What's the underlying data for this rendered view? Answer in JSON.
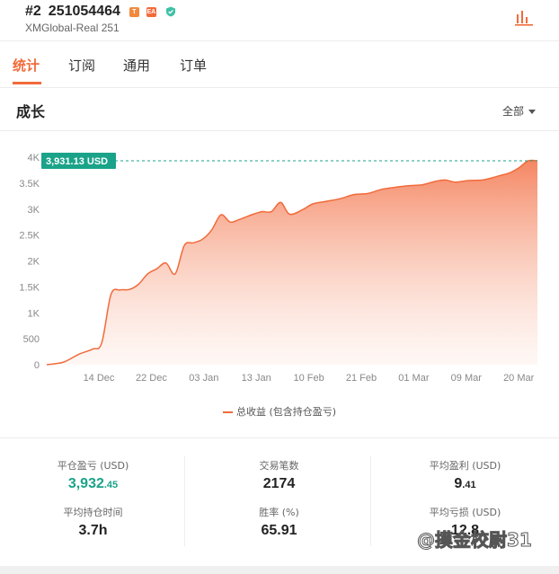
{
  "account": {
    "rank": "#2",
    "id": "251054464",
    "server": "XMGlobal-Real 251",
    "badge_t": "T",
    "badge_ea": "EA"
  },
  "tabs": [
    {
      "label": "统计",
      "active": true
    },
    {
      "label": "订阅",
      "active": false
    },
    {
      "label": "通用",
      "active": false
    },
    {
      "label": "订单",
      "active": false
    }
  ],
  "growth": {
    "title": "成长",
    "filter_label": "全部"
  },
  "chart_data": {
    "type": "area",
    "current_label": "3,931.13 USD",
    "current_value": 3931.13,
    "y_ticks": [
      "0",
      "500",
      "1K",
      "1.5K",
      "2K",
      "2.5K",
      "3K",
      "3.5K",
      "4K"
    ],
    "ylim": [
      0,
      4000
    ],
    "x_ticks": [
      "14 Dec",
      "22 Dec",
      "03 Jan",
      "13 Jan",
      "10 Feb",
      "21 Feb",
      "01 Mar",
      "09 Mar",
      "20 Mar"
    ],
    "series": [
      {
        "name": "总收益 (包含持仓盈亏)",
        "points": [
          [
            0,
            0
          ],
          [
            0.02,
            20
          ],
          [
            0.04,
            60
          ],
          [
            0.07,
            200
          ],
          [
            0.1,
            300
          ],
          [
            0.12,
            420
          ],
          [
            0.14,
            1350
          ],
          [
            0.16,
            1440
          ],
          [
            0.18,
            1450
          ],
          [
            0.2,
            1550
          ],
          [
            0.22,
            1750
          ],
          [
            0.24,
            1850
          ],
          [
            0.26,
            1960
          ],
          [
            0.28,
            1750
          ],
          [
            0.3,
            2300
          ],
          [
            0.32,
            2350
          ],
          [
            0.34,
            2420
          ],
          [
            0.36,
            2600
          ],
          [
            0.38,
            2890
          ],
          [
            0.4,
            2750
          ],
          [
            0.42,
            2800
          ],
          [
            0.45,
            2900
          ],
          [
            0.47,
            2950
          ],
          [
            0.49,
            2950
          ],
          [
            0.51,
            3130
          ],
          [
            0.53,
            2900
          ],
          [
            0.56,
            3000
          ],
          [
            0.58,
            3100
          ],
          [
            0.61,
            3150
          ],
          [
            0.64,
            3200
          ],
          [
            0.67,
            3280
          ],
          [
            0.7,
            3300
          ],
          [
            0.73,
            3380
          ],
          [
            0.76,
            3420
          ],
          [
            0.79,
            3450
          ],
          [
            0.82,
            3470
          ],
          [
            0.85,
            3540
          ],
          [
            0.87,
            3560
          ],
          [
            0.89,
            3520
          ],
          [
            0.92,
            3550
          ],
          [
            0.95,
            3560
          ],
          [
            0.97,
            3600
          ],
          [
            0.99,
            3650
          ],
          [
            1.01,
            3700
          ],
          [
            1.03,
            3800
          ],
          [
            1.05,
            3930
          ],
          [
            1.07,
            3931.13
          ]
        ]
      }
    ],
    "grid": false,
    "legend_position": "bottom"
  },
  "stats": {
    "closed_pl_label": "平仓盈亏 (USD)",
    "closed_pl_main": "3,932",
    "closed_pl_decimal": ".45",
    "trades_label": "交易笔数",
    "trades_value": "2174",
    "avg_profit_label": "平均盈利 (USD)",
    "avg_profit_main": "9",
    "avg_profit_decimal": ".41",
    "avg_hold_label": "平均持仓时间",
    "avg_hold_value": "3.7h",
    "win_rate_label": "胜率 (%)",
    "win_rate_value": "65.91",
    "avg_loss_label": "平均亏损 (USD)",
    "avg_loss_value": "12.8"
  },
  "watermark": "@摸金校尉31",
  "colors": {
    "accent": "#f26a3a",
    "positive": "#1aa389"
  }
}
